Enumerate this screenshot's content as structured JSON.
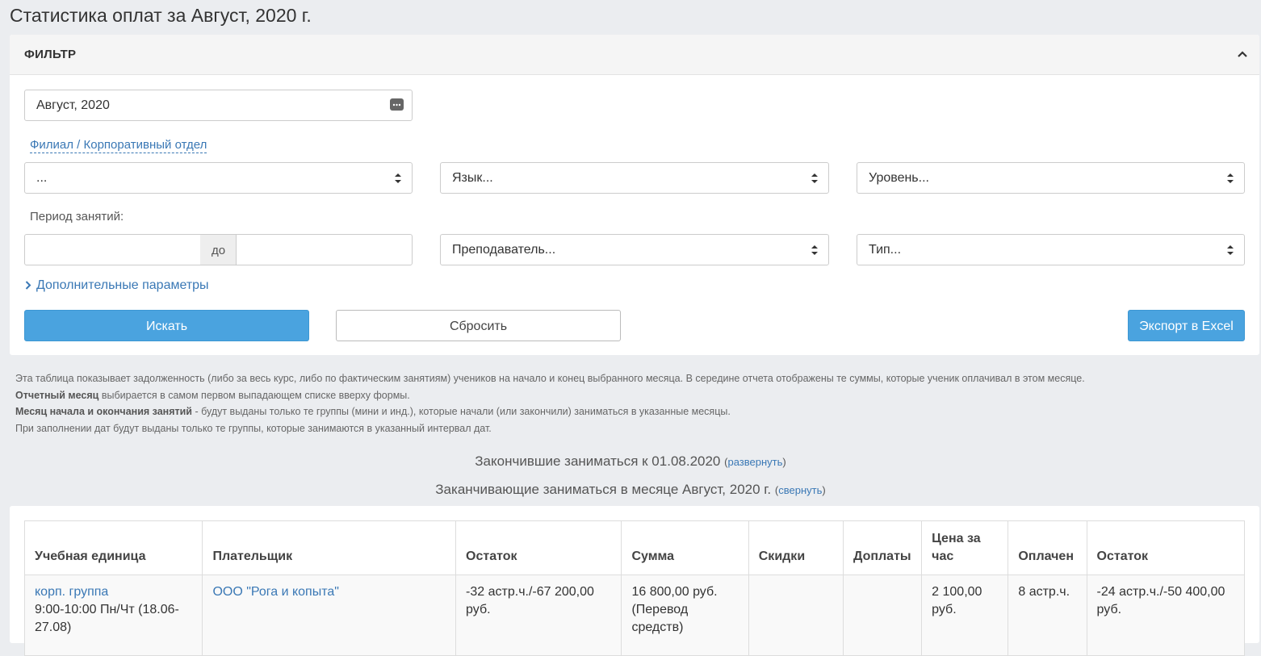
{
  "page": {
    "title": "Статистика оплат за Август, 2020 г."
  },
  "filter": {
    "header": "ФИЛЬТР",
    "month_value": "Август, 2020",
    "branch_link": "Филиал / Корпоративный отдел",
    "branch_select": "...",
    "language_select": "Язык...",
    "level_select": "Уровень...",
    "period_label": "Период занятий:",
    "period_from": "",
    "period_sep": "до",
    "period_to": "",
    "teacher_select": "Преподаватель...",
    "type_select": "Тип...",
    "advanced_link": "Дополнительные параметры",
    "search_button": "Искать",
    "reset_button": "Сбросить",
    "export_button": "Экспорт в Excel"
  },
  "info": {
    "line1": "Эта таблица показывает задолженность (либо за весь курс, либо по фактическим занятиям) учеников на начало и конец выбранного месяца. В середине отчета отображены те суммы, которые ученик оплачивал в этом месяце.",
    "line2_bold": "Отчетный месяц",
    "line2_rest": " выбирается в самом первом выпадающем списке вверху формы.",
    "line3_bold": "Месяц начала и окончания занятий",
    "line3_rest": " - будут выданы только те группы (мини и инд.), которые начали (или закончили) заниматься в указанные месяцы.",
    "line4": "При заполнении дат будут выданы только те группы, которые занимаются в указанный интервал дат."
  },
  "sections": {
    "finished_text": "Закончившие заниматься к 01.08.2020",
    "finished_link": "развернуть",
    "finishing_text": "Заканчивающие заниматься в месяце Август, 2020 г.",
    "finishing_link": "свернуть"
  },
  "table": {
    "headers": [
      "Учебная единица",
      "Плательщик",
      "Остаток",
      "Сумма",
      "Скидки",
      "Доплаты",
      "Цена за час",
      "Оплачен",
      "Остаток"
    ],
    "rows": [
      {
        "unit_link": "корп. группа",
        "unit_detail": "9:00-10:00 Пн/Чт (18.06-27.08)",
        "payer": "ООО \"Рога и копыта\"",
        "balance_start": "-32 астр.ч./-67 200,00 руб.",
        "sum": "16 800,00 руб. (Перевод средств)",
        "discounts": "",
        "surcharges": "",
        "price_per_hour": "2 100,00 руб.",
        "paid": "8 астр.ч.",
        "balance_end": "-24 астр.ч./-50 400,00 руб."
      }
    ]
  },
  "colors": {
    "accent": "#4aa3df",
    "link": "#3a78b5",
    "background": "#ebedf0"
  }
}
